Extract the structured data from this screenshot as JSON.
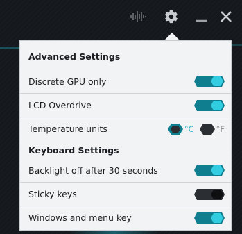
{
  "settings": {
    "advanced_title": "Advanced Settings",
    "keyboard_title": "Keyboard Settings",
    "rows": [
      {
        "label": "Discrete GPU only",
        "state": "on"
      },
      {
        "label": "LCD Overdrive",
        "state": "on"
      },
      {
        "label": "Temperature units",
        "state": "celsius"
      },
      {
        "label": "Backlight off after 30 seconds",
        "state": "on"
      },
      {
        "label": "Sticky keys",
        "state": "off"
      },
      {
        "label": "Windows and menu key",
        "state": "on"
      }
    ],
    "units": {
      "celsius": "°C",
      "fahrenheit": "°F",
      "selected": "celsius"
    }
  },
  "icons": {
    "audio": "equalizer-icon",
    "settings": "gear-icon",
    "minimize": "minimize-icon",
    "close": "close-icon"
  },
  "colors": {
    "accent": "#1fb6c9",
    "toggle_off": "#2b2f33",
    "panel_bg": "#f2f3f4"
  }
}
